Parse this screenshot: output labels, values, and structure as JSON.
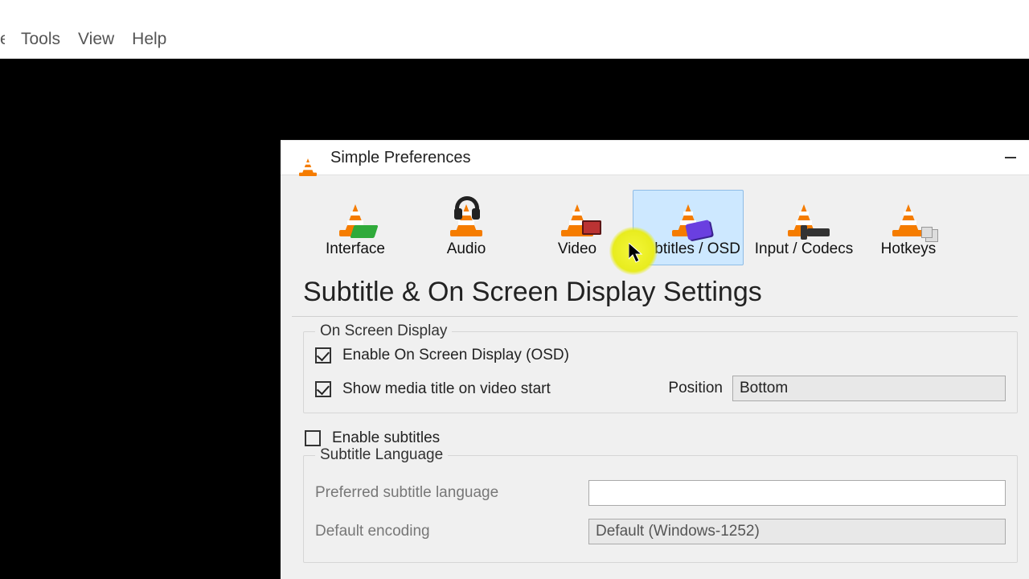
{
  "menubar": {
    "partial": "e",
    "tools": "Tools",
    "view": "View",
    "help": "Help"
  },
  "dialog": {
    "title": "Simple Preferences",
    "tabs": {
      "interface": "Interface",
      "audio": "Audio",
      "video": "Video",
      "subtitles": "Subtitles / OSD",
      "input": "Input / Codecs",
      "hotkeys": "Hotkeys"
    },
    "page_title": "Subtitle & On Screen Display Settings",
    "osd": {
      "legend": "On Screen Display",
      "enable_osd": {
        "label": "Enable On Screen Display (OSD)",
        "checked": true
      },
      "show_title": {
        "label": "Show media title on video start",
        "checked": true
      },
      "position_label": "Position",
      "position_value": "Bottom"
    },
    "enable_subtitles": {
      "label": "Enable subtitles",
      "checked": false
    },
    "sublang": {
      "legend": "Subtitle Language",
      "preferred_label": "Preferred subtitle language",
      "preferred_value": "",
      "encoding_label": "Default encoding",
      "encoding_value": "Default (Windows-1252)"
    }
  }
}
